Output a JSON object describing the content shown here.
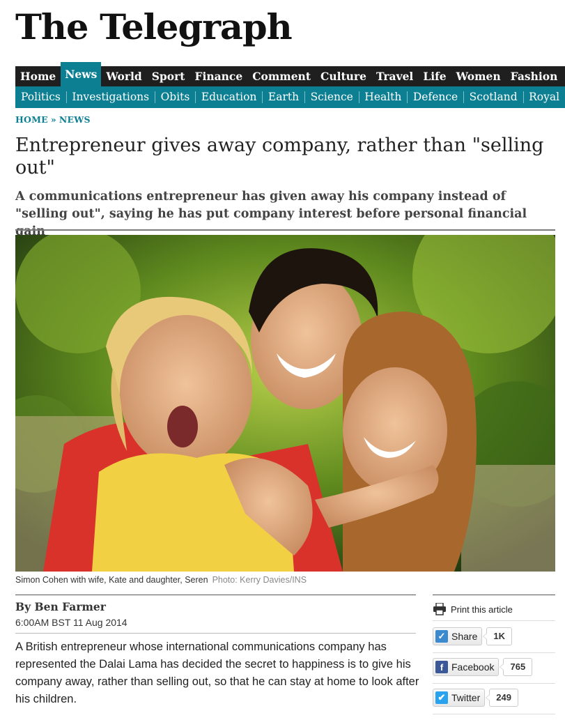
{
  "brand": {
    "logo_text": "The Telegraph"
  },
  "nav_primary": [
    {
      "label": "Home"
    },
    {
      "label": "News",
      "active": true
    },
    {
      "label": "World"
    },
    {
      "label": "Sport"
    },
    {
      "label": "Finance"
    },
    {
      "label": "Comment"
    },
    {
      "label": "Culture"
    },
    {
      "label": "Travel"
    },
    {
      "label": "Life"
    },
    {
      "label": "Women"
    },
    {
      "label": "Fashion"
    }
  ],
  "nav_secondary": [
    {
      "label": "Politics"
    },
    {
      "label": "Investigations"
    },
    {
      "label": "Obits"
    },
    {
      "label": "Education"
    },
    {
      "label": "Earth"
    },
    {
      "label": "Science"
    },
    {
      "label": "Health"
    },
    {
      "label": "Defence"
    },
    {
      "label": "Scotland"
    },
    {
      "label": "Royal"
    }
  ],
  "breadcrumb": {
    "home": "HOME",
    "separator": "»",
    "section": "NEWS"
  },
  "article": {
    "headline": "Entrepreneur gives away company, rather than \"selling out\"",
    "standfirst": "A communications entrepreneur has given away his company instead of \"selling out\", saying he has put company interest before personal financial gain",
    "caption": "Simon Cohen with wife, Kate and daughter, Seren",
    "photo_credit": "Photo: Kerry Davies/INS",
    "byline": "By Ben Farmer",
    "dateline": "6:00AM BST 11 Aug 2014",
    "body": "A British entrepreneur whose international communications company has represented the Dalai Lama has decided the secret to happiness is to give his company away, rather than selling out, so that he can stay at home to look after his children."
  },
  "sidebar": {
    "print_label": "Print this article",
    "print_icon": "printer-icon",
    "share": [
      {
        "label": "Share",
        "count": "1K",
        "icon": "share-icon",
        "color": "#3b8ad0"
      },
      {
        "label": "Facebook",
        "count": "765",
        "icon": "facebook-icon",
        "color": "#3b5998"
      },
      {
        "label": "Twitter",
        "count": "249",
        "icon": "twitter-icon",
        "color": "#2aa3ef"
      }
    ]
  },
  "colors": {
    "nav_dark": "#1f1f1f",
    "accent": "#0d7f92"
  }
}
